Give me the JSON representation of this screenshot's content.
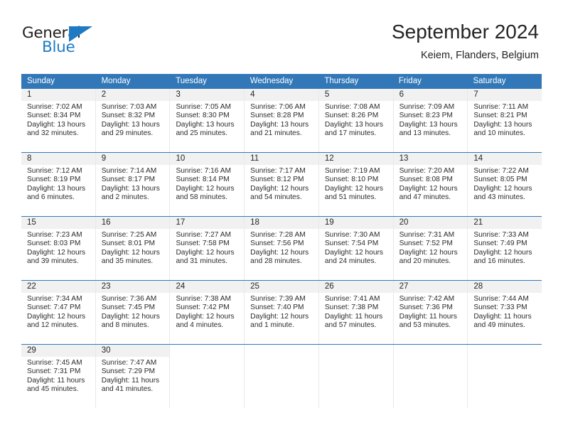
{
  "brand": {
    "name_part1": "General",
    "name_part2": "Blue",
    "triangle_color": "#1f7ac4"
  },
  "header": {
    "title": "September 2024",
    "subtitle": "Keiem, Flanders, Belgium"
  },
  "theme": {
    "header_blue": "#3278b8",
    "daynum_band": "#f1f1f1",
    "text": "#2b2b2b"
  },
  "calendar": {
    "weekday_headers": [
      "Sunday",
      "Monday",
      "Tuesday",
      "Wednesday",
      "Thursday",
      "Friday",
      "Saturday"
    ],
    "weeks": [
      [
        {
          "day": "1",
          "sunrise": "Sunrise: 7:02 AM",
          "sunset": "Sunset: 8:34 PM",
          "daylight1": "Daylight: 13 hours",
          "daylight2": "and 32 minutes."
        },
        {
          "day": "2",
          "sunrise": "Sunrise: 7:03 AM",
          "sunset": "Sunset: 8:32 PM",
          "daylight1": "Daylight: 13 hours",
          "daylight2": "and 29 minutes."
        },
        {
          "day": "3",
          "sunrise": "Sunrise: 7:05 AM",
          "sunset": "Sunset: 8:30 PM",
          "daylight1": "Daylight: 13 hours",
          "daylight2": "and 25 minutes."
        },
        {
          "day": "4",
          "sunrise": "Sunrise: 7:06 AM",
          "sunset": "Sunset: 8:28 PM",
          "daylight1": "Daylight: 13 hours",
          "daylight2": "and 21 minutes."
        },
        {
          "day": "5",
          "sunrise": "Sunrise: 7:08 AM",
          "sunset": "Sunset: 8:26 PM",
          "daylight1": "Daylight: 13 hours",
          "daylight2": "and 17 minutes."
        },
        {
          "day": "6",
          "sunrise": "Sunrise: 7:09 AM",
          "sunset": "Sunset: 8:23 PM",
          "daylight1": "Daylight: 13 hours",
          "daylight2": "and 13 minutes."
        },
        {
          "day": "7",
          "sunrise": "Sunrise: 7:11 AM",
          "sunset": "Sunset: 8:21 PM",
          "daylight1": "Daylight: 13 hours",
          "daylight2": "and 10 minutes."
        }
      ],
      [
        {
          "day": "8",
          "sunrise": "Sunrise: 7:12 AM",
          "sunset": "Sunset: 8:19 PM",
          "daylight1": "Daylight: 13 hours",
          "daylight2": "and 6 minutes."
        },
        {
          "day": "9",
          "sunrise": "Sunrise: 7:14 AM",
          "sunset": "Sunset: 8:17 PM",
          "daylight1": "Daylight: 13 hours",
          "daylight2": "and 2 minutes."
        },
        {
          "day": "10",
          "sunrise": "Sunrise: 7:16 AM",
          "sunset": "Sunset: 8:14 PM",
          "daylight1": "Daylight: 12 hours",
          "daylight2": "and 58 minutes."
        },
        {
          "day": "11",
          "sunrise": "Sunrise: 7:17 AM",
          "sunset": "Sunset: 8:12 PM",
          "daylight1": "Daylight: 12 hours",
          "daylight2": "and 54 minutes."
        },
        {
          "day": "12",
          "sunrise": "Sunrise: 7:19 AM",
          "sunset": "Sunset: 8:10 PM",
          "daylight1": "Daylight: 12 hours",
          "daylight2": "and 51 minutes."
        },
        {
          "day": "13",
          "sunrise": "Sunrise: 7:20 AM",
          "sunset": "Sunset: 8:08 PM",
          "daylight1": "Daylight: 12 hours",
          "daylight2": "and 47 minutes."
        },
        {
          "day": "14",
          "sunrise": "Sunrise: 7:22 AM",
          "sunset": "Sunset: 8:05 PM",
          "daylight1": "Daylight: 12 hours",
          "daylight2": "and 43 minutes."
        }
      ],
      [
        {
          "day": "15",
          "sunrise": "Sunrise: 7:23 AM",
          "sunset": "Sunset: 8:03 PM",
          "daylight1": "Daylight: 12 hours",
          "daylight2": "and 39 minutes."
        },
        {
          "day": "16",
          "sunrise": "Sunrise: 7:25 AM",
          "sunset": "Sunset: 8:01 PM",
          "daylight1": "Daylight: 12 hours",
          "daylight2": "and 35 minutes."
        },
        {
          "day": "17",
          "sunrise": "Sunrise: 7:27 AM",
          "sunset": "Sunset: 7:58 PM",
          "daylight1": "Daylight: 12 hours",
          "daylight2": "and 31 minutes."
        },
        {
          "day": "18",
          "sunrise": "Sunrise: 7:28 AM",
          "sunset": "Sunset: 7:56 PM",
          "daylight1": "Daylight: 12 hours",
          "daylight2": "and 28 minutes."
        },
        {
          "day": "19",
          "sunrise": "Sunrise: 7:30 AM",
          "sunset": "Sunset: 7:54 PM",
          "daylight1": "Daylight: 12 hours",
          "daylight2": "and 24 minutes."
        },
        {
          "day": "20",
          "sunrise": "Sunrise: 7:31 AM",
          "sunset": "Sunset: 7:52 PM",
          "daylight1": "Daylight: 12 hours",
          "daylight2": "and 20 minutes."
        },
        {
          "day": "21",
          "sunrise": "Sunrise: 7:33 AM",
          "sunset": "Sunset: 7:49 PM",
          "daylight1": "Daylight: 12 hours",
          "daylight2": "and 16 minutes."
        }
      ],
      [
        {
          "day": "22",
          "sunrise": "Sunrise: 7:34 AM",
          "sunset": "Sunset: 7:47 PM",
          "daylight1": "Daylight: 12 hours",
          "daylight2": "and 12 minutes."
        },
        {
          "day": "23",
          "sunrise": "Sunrise: 7:36 AM",
          "sunset": "Sunset: 7:45 PM",
          "daylight1": "Daylight: 12 hours",
          "daylight2": "and 8 minutes."
        },
        {
          "day": "24",
          "sunrise": "Sunrise: 7:38 AM",
          "sunset": "Sunset: 7:42 PM",
          "daylight1": "Daylight: 12 hours",
          "daylight2": "and 4 minutes."
        },
        {
          "day": "25",
          "sunrise": "Sunrise: 7:39 AM",
          "sunset": "Sunset: 7:40 PM",
          "daylight1": "Daylight: 12 hours",
          "daylight2": "and 1 minute."
        },
        {
          "day": "26",
          "sunrise": "Sunrise: 7:41 AM",
          "sunset": "Sunset: 7:38 PM",
          "daylight1": "Daylight: 11 hours",
          "daylight2": "and 57 minutes."
        },
        {
          "day": "27",
          "sunrise": "Sunrise: 7:42 AM",
          "sunset": "Sunset: 7:36 PM",
          "daylight1": "Daylight: 11 hours",
          "daylight2": "and 53 minutes."
        },
        {
          "day": "28",
          "sunrise": "Sunrise: 7:44 AM",
          "sunset": "Sunset: 7:33 PM",
          "daylight1": "Daylight: 11 hours",
          "daylight2": "and 49 minutes."
        }
      ],
      [
        {
          "day": "29",
          "sunrise": "Sunrise: 7:45 AM",
          "sunset": "Sunset: 7:31 PM",
          "daylight1": "Daylight: 11 hours",
          "daylight2": "and 45 minutes."
        },
        {
          "day": "30",
          "sunrise": "Sunrise: 7:47 AM",
          "sunset": "Sunset: 7:29 PM",
          "daylight1": "Daylight: 11 hours",
          "daylight2": "and 41 minutes."
        },
        {
          "day": "",
          "sunrise": "",
          "sunset": "",
          "daylight1": "",
          "daylight2": ""
        },
        {
          "day": "",
          "sunrise": "",
          "sunset": "",
          "daylight1": "",
          "daylight2": ""
        },
        {
          "day": "",
          "sunrise": "",
          "sunset": "",
          "daylight1": "",
          "daylight2": ""
        },
        {
          "day": "",
          "sunrise": "",
          "sunset": "",
          "daylight1": "",
          "daylight2": ""
        },
        {
          "day": "",
          "sunrise": "",
          "sunset": "",
          "daylight1": "",
          "daylight2": ""
        }
      ]
    ]
  }
}
